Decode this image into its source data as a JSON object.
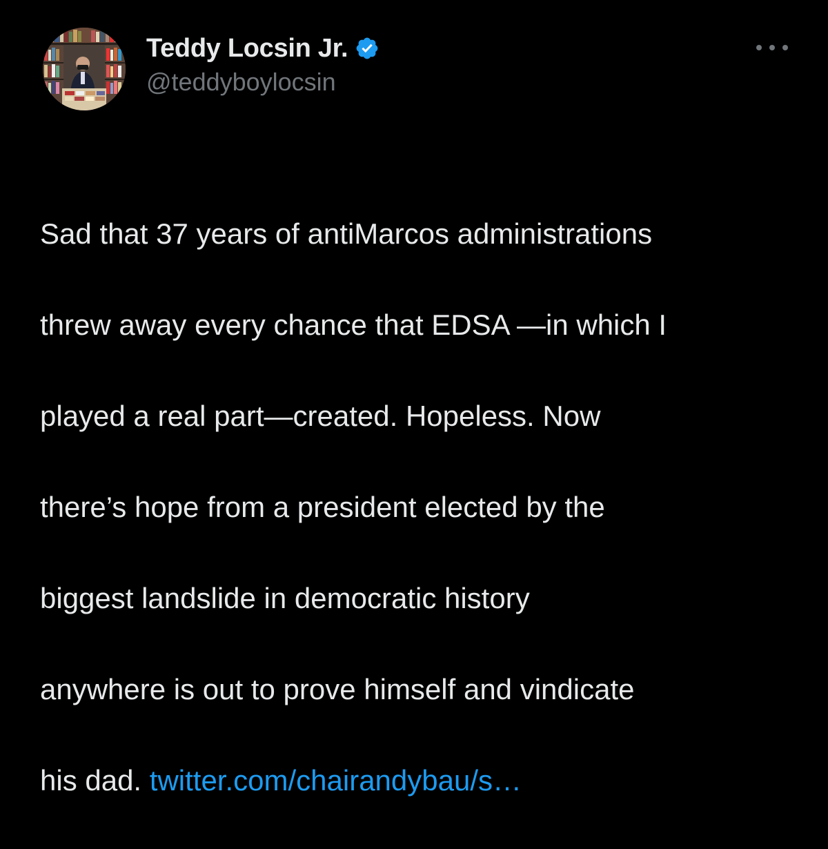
{
  "tweet": {
    "author": {
      "display_name": "Teddy Locsin Jr.",
      "handle": "@teddyboylocsin",
      "verified_icon": "verified-badge-icon",
      "badge_color": "#1d9bf0"
    },
    "more_icon": "more-options-icon",
    "body_lines": [
      "Sad that 37 years of antiMarcos administrations",
      "threw away every chance that EDSA —in which I",
      "played a real part—created. Hopeless. Now",
      "there’s hope from a president elected by the",
      "biggest landslide in democratic history",
      "anywhere is out to prove himself and vindicate"
    ],
    "last_line_prefix": "his dad. ",
    "link_text": "twitter.com/chairandybau/s…",
    "link_color": "#1d9bf0"
  }
}
